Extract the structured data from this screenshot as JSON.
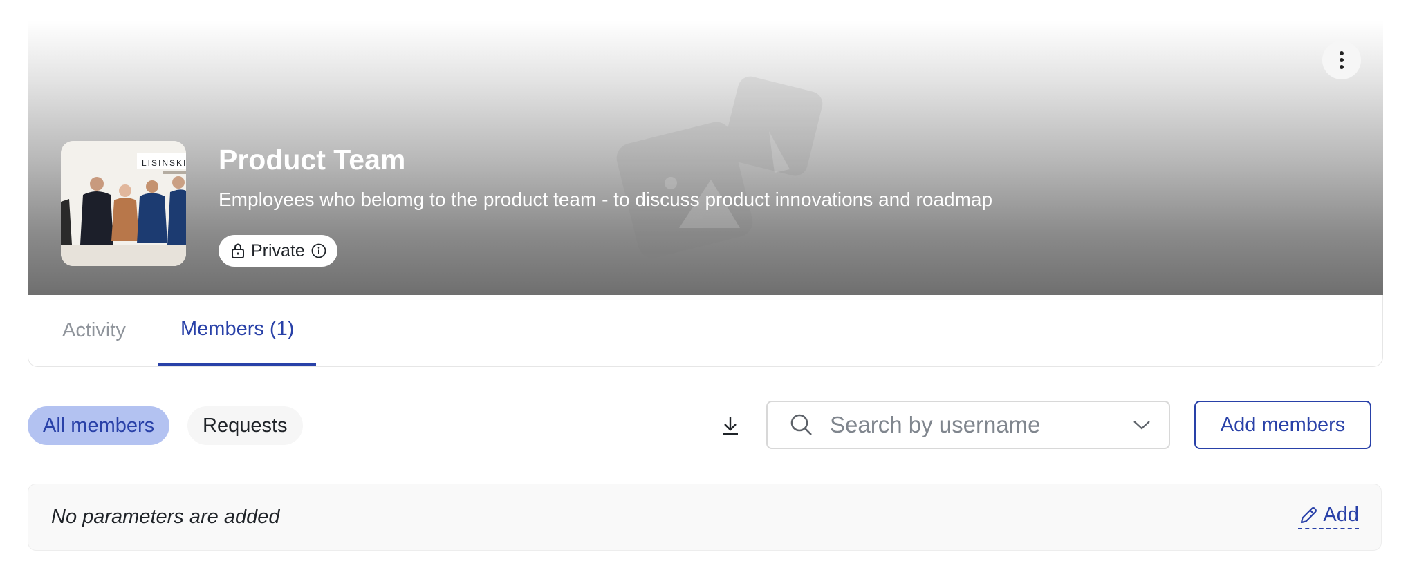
{
  "group": {
    "title": "Product Team",
    "description": "Employees who belomg to the product team - to discuss product innovations and roadmap",
    "privacy": "Private",
    "photo_sign": "LISINSKI"
  },
  "tabs": [
    {
      "label": "Activity",
      "active": false
    },
    {
      "label": "Members (1)",
      "active": true
    }
  ],
  "filters": [
    {
      "label": "All members",
      "active": true
    },
    {
      "label": "Requests",
      "active": false
    }
  ],
  "search": {
    "placeholder": "Search by username",
    "value": ""
  },
  "actions": {
    "add_members_label": "Add members"
  },
  "parameters": {
    "empty_text": "No parameters are added",
    "add_label": "Add"
  },
  "colors": {
    "accent": "#2941a8",
    "active_pill_bg": "#b3c2f1",
    "header_bottom": "#6f6f6f"
  },
  "icons": [
    "more-vertical-icon",
    "image-placeholder-icon",
    "lock-icon",
    "info-icon",
    "download-icon",
    "search-icon",
    "chevron-down-icon",
    "pencil-icon"
  ]
}
